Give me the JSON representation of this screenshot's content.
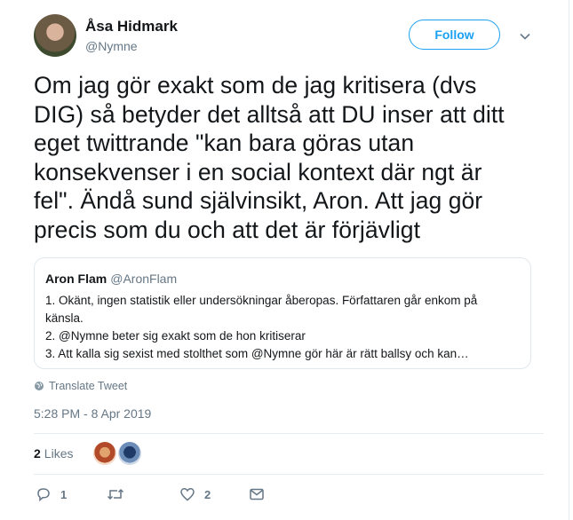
{
  "author": {
    "name": "Åsa Hidmark",
    "handle": "@Nymne"
  },
  "follow_label": "Follow",
  "tweet_text": "Om jag gör exakt som de jag kritisera (dvs\nDIG) så betyder det alltså att DU inser att ditt\neget twittrande \"kan bara göras utan\nkonsekvenser i en social kontext där ngt är\nfel\". Ändå sund självinsikt, Aron. Att jag gör\nprecis som du och att det är förjävligt",
  "quoted_tweet": {
    "name": "Aron Flam",
    "handle": "@AronFlam",
    "lines": [
      "1. Okänt, ingen statistik eller undersökningar åberopas. Författaren går enkom på",
      "känsla.",
      "2. @Nymne beter sig exakt som de hon kritiserar",
      "3. Att kalla sig sexist med stolthet som @Nymne gör här är rätt ballsy och kan…"
    ]
  },
  "translate_label": "Translate Tweet",
  "timestamp": "5:28 PM - 8 Apr 2019",
  "likes": {
    "count": "2",
    "label": "Likes"
  },
  "actions": {
    "reply_count": "1",
    "retweet_count": "",
    "like_count": "2"
  },
  "icons": [
    "chevron-down-icon",
    "globe-icon",
    "reply-icon",
    "retweet-icon",
    "heart-icon",
    "envelope-icon"
  ],
  "colors": {
    "accent": "#1da1f2",
    "muted": "#657786",
    "text": "#14171a",
    "border": "#e1e8ed"
  }
}
